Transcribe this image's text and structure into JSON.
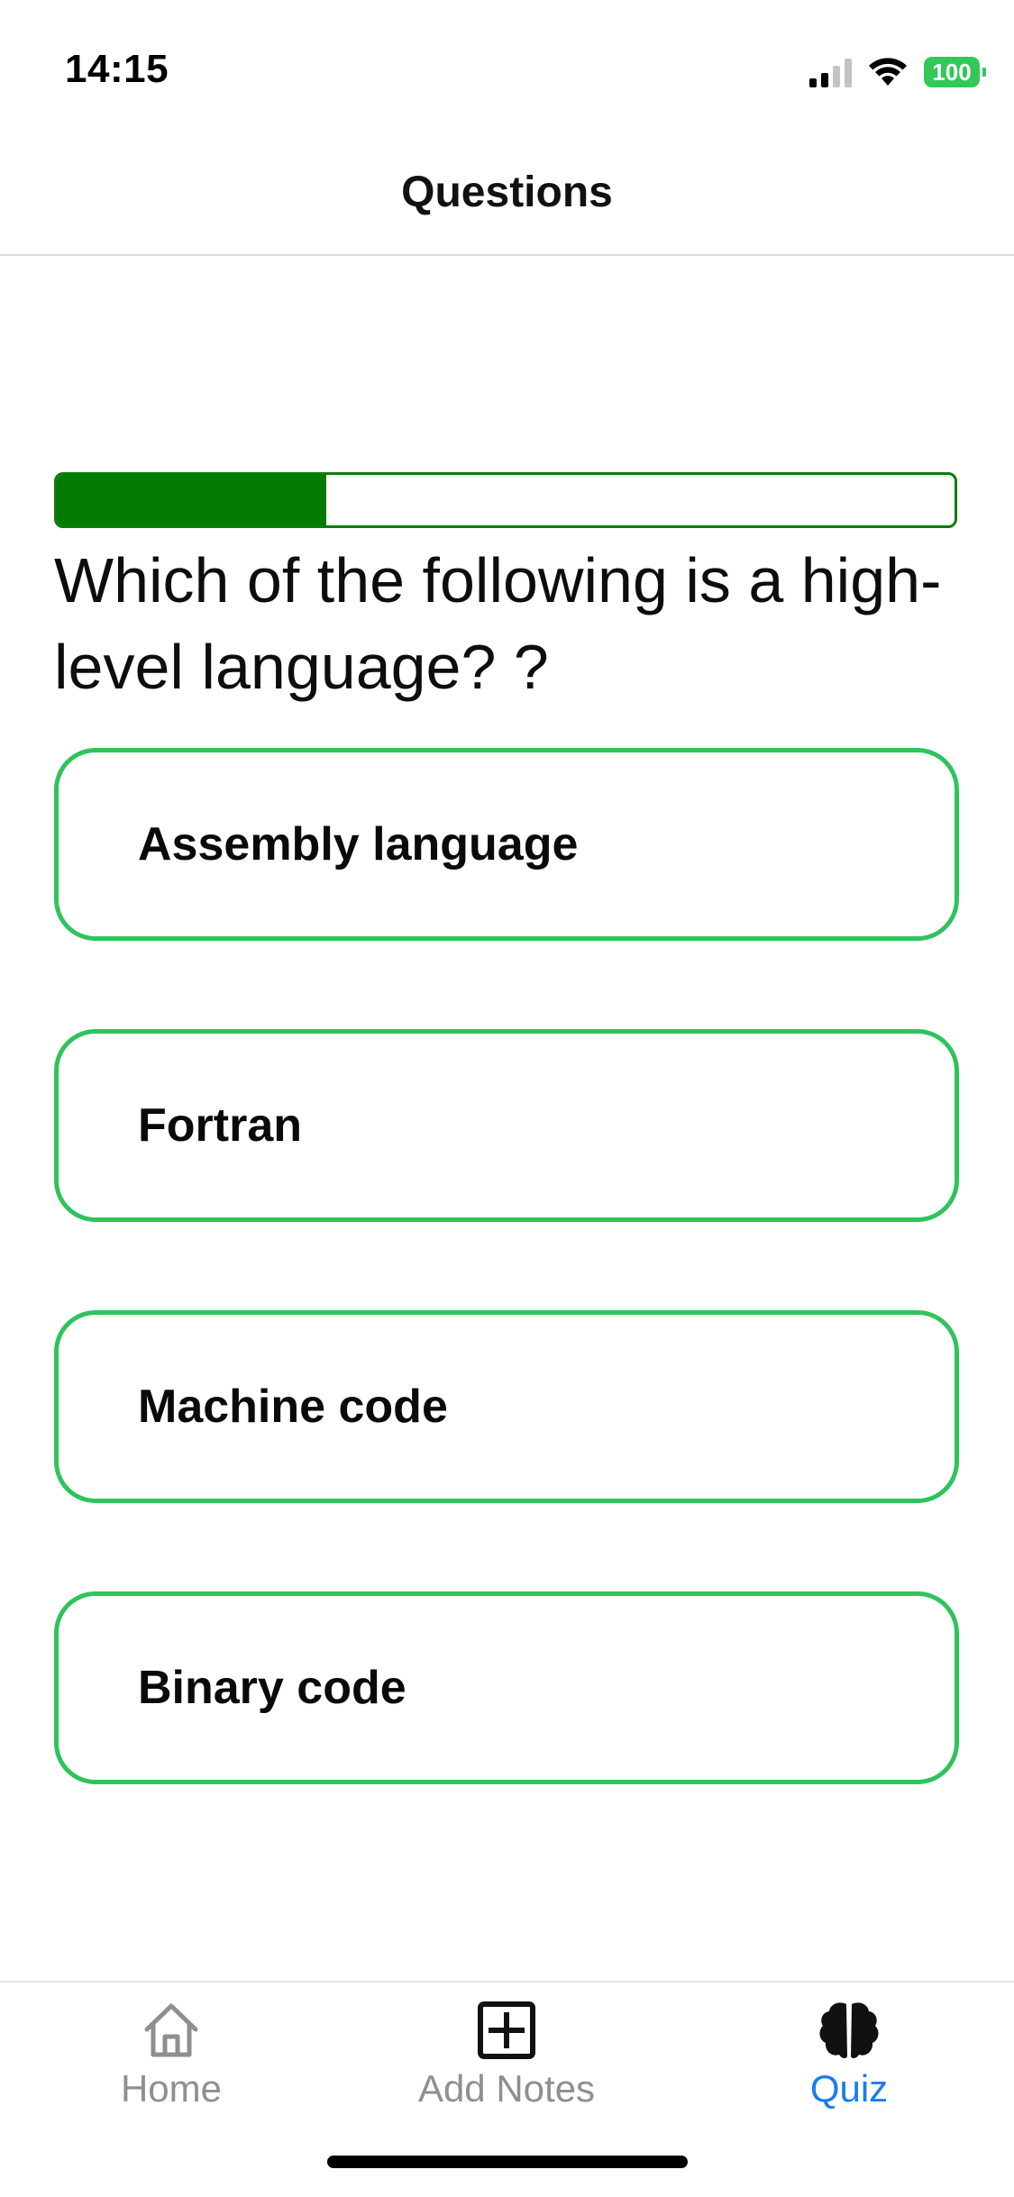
{
  "status_bar": {
    "time": "14:15",
    "battery": "100",
    "icons": [
      "cellular-signal-icon",
      "wifi-icon",
      "battery-icon"
    ]
  },
  "nav": {
    "title": "Questions"
  },
  "progress": {
    "fraction": 0.3
  },
  "question": {
    "text": "Which of the following is a high-level language? ?"
  },
  "options": [
    {
      "label": "Assembly language"
    },
    {
      "label": "Fortran"
    },
    {
      "label": "Machine code"
    },
    {
      "label": "Binary code"
    }
  ],
  "tab_bar": {
    "tabs": [
      {
        "label": "Home",
        "icon": "house-icon",
        "active": false
      },
      {
        "label": "Add Notes",
        "icon": "plus-square-icon",
        "active": false
      },
      {
        "label": "Quiz",
        "icon": "brain-icon",
        "active": true
      }
    ]
  },
  "colors": {
    "progress": "#037c03",
    "option_border": "#2ec45c",
    "active_tab": "#1a7cf0",
    "inactive_tab": "#8e8e93",
    "battery": "#34c759"
  }
}
